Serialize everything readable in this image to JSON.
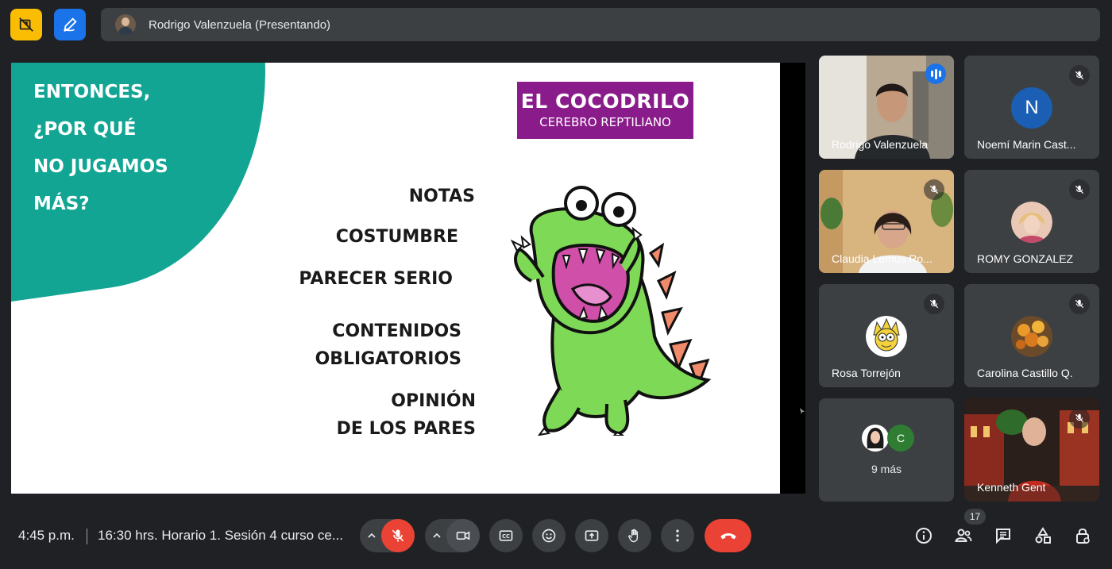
{
  "presenter_bar": {
    "label": "Rodrigo Valenzuela (Presentando)"
  },
  "slide": {
    "question_lines": [
      "ENTONCES,",
      "¿POR QUÉ",
      "NO JUGAMOS",
      "MÁS?"
    ],
    "box_title": "EL COCODRILO",
    "box_subtitle": "CEREBRO REPTILIANO",
    "reasons": [
      "NOTAS",
      "COSTUMBRE",
      "PARECER SERIO",
      "CONTENIDOS",
      "OBLIGATORIOS",
      "OPINIÓN",
      "DE LOS PARES"
    ],
    "colors": {
      "teal": "#12a593",
      "purple": "#8a1b8a"
    }
  },
  "participants": [
    {
      "name": "Rodrigo Valenzuela",
      "state": "speaking"
    },
    {
      "name": "Noemí Marin Cast...",
      "initial": "N",
      "avatar_color": "#1a5fb4",
      "state": "muted"
    },
    {
      "name": "Claudia Lemus Ro...",
      "state": "muted"
    },
    {
      "name": "ROMY GONZALEZ",
      "state": "muted"
    },
    {
      "name": "Rosa Torrejón",
      "state": "muted"
    },
    {
      "name": "Carolina Castillo Q.",
      "state": "muted"
    },
    {
      "more_label": "9 más",
      "initial": "C"
    },
    {
      "name": "Kenneth Gent",
      "state": "muted"
    }
  ],
  "bottom_bar": {
    "time": "4:45 p.m.",
    "meeting_title": "16:30 hrs. Horario 1. Sesión 4 curso ce...",
    "people_count": "17",
    "colors": {
      "end_call": "#ea4335",
      "mic_off": "#ea4335"
    }
  }
}
